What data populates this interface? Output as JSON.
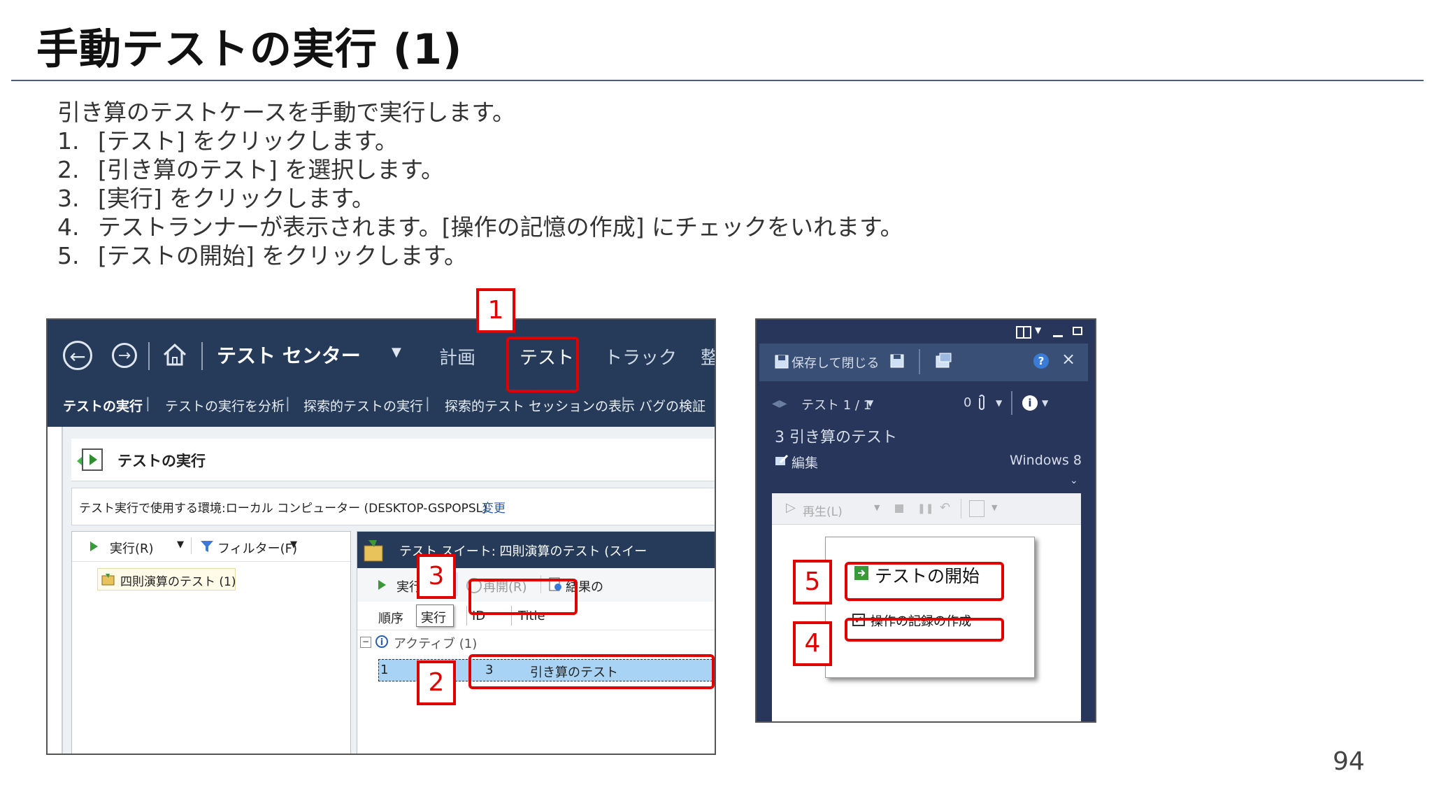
{
  "slide": {
    "title": "手動テストの実行 (1)",
    "intro": "引き算のテストケースを手動で実行します。",
    "steps": [
      {
        "num": "1.",
        "text": "[テスト] をクリックします。"
      },
      {
        "num": "2.",
        "text": "[引き算のテスト] を選択します。"
      },
      {
        "num": "3.",
        "text": "[実行] をクリックします。"
      },
      {
        "num": "4.",
        "text": "テストランナーが表示されます。[操作の記憶の作成] にチェックをいれます。"
      },
      {
        "num": "5.",
        "text": "[テストの開始] をクリックします。"
      }
    ],
    "page_number": "94"
  },
  "test_center": {
    "app_name": "テスト センター",
    "menu": [
      "計画",
      "テスト",
      "トラック",
      "整"
    ],
    "submenu": [
      "テストの実行",
      "テストの実行を分析",
      "探索的テストの実行",
      "探索的テスト セッションの表示",
      "バグの検証"
    ],
    "header": "テストの実行",
    "environment_label": "テスト実行で使用する環境:ローカル コンピューター (DESKTOP-GSPOPSL)",
    "change_link": "変更",
    "run_menu": "実行(R)",
    "filter_menu": "フィルター(F)",
    "tree_item": "四則演算のテスト (1)",
    "suite_title": "テスト スイート:  四則演算のテスト (スイー",
    "run_button": "実行(U)",
    "resume_button": "再開(R)",
    "results_button": "結果の",
    "tooltip": "実行",
    "columns": [
      "順序",
      "ID",
      "Title"
    ],
    "group": "アクティブ (1)",
    "row": {
      "order": "1",
      "id": "3",
      "title": "引き算のテスト"
    }
  },
  "test_runner": {
    "save_close": "保存して閉じる",
    "test_counter": "テスト 1 / 1",
    "attach_count": "0",
    "test_name": "3 引き算のテスト",
    "edit": "編集",
    "os": "Windows 8",
    "play": "再生(L)",
    "start_test": "テストの開始",
    "create_recording": "操作の記録の作成"
  },
  "callouts": [
    "1",
    "2",
    "3",
    "4",
    "5"
  ],
  "colors": {
    "accent_red": "#e00000",
    "nav_blue": "#253b59",
    "runner_blue": "#27365a"
  }
}
